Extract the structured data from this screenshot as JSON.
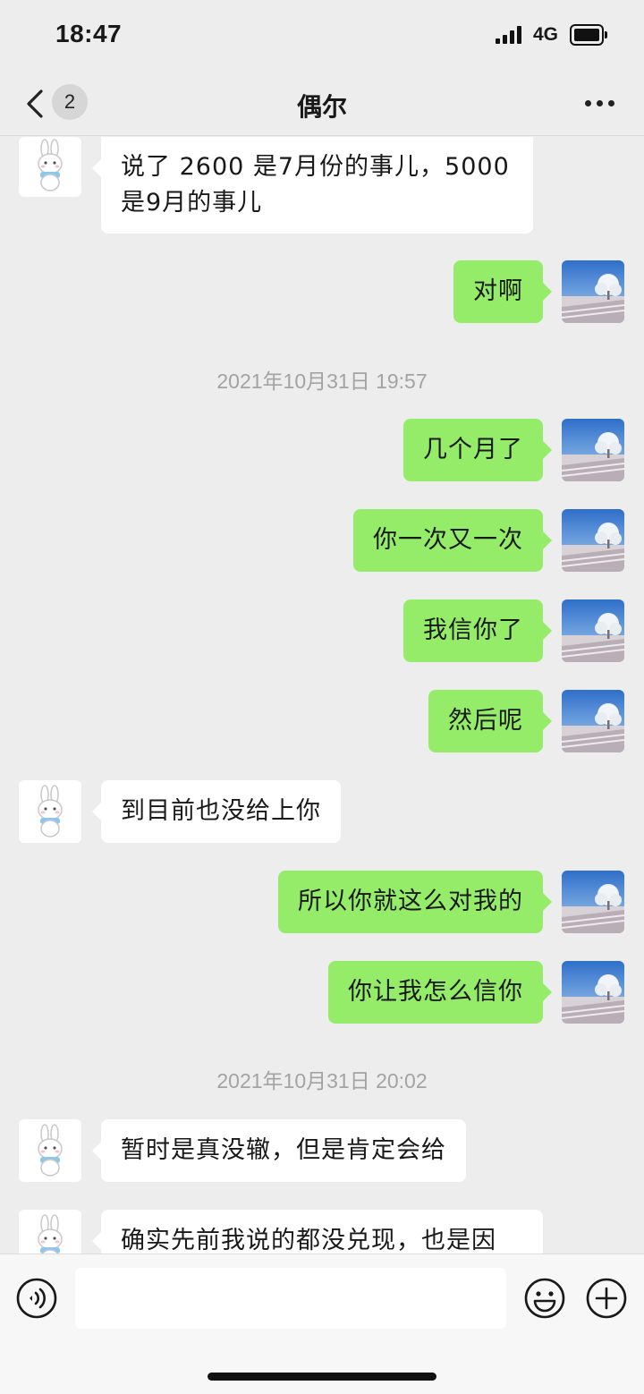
{
  "status_bar": {
    "time": "18:47",
    "network": "4G"
  },
  "nav": {
    "unread_count": "2",
    "title": "偶尔"
  },
  "messages": [
    {
      "side": "in",
      "text": "说了 2600 是7月份的事儿，5000 是9月的事儿"
    },
    {
      "side": "out",
      "text": "对啊"
    },
    {
      "timestamp": "2021年10月31日 19:57"
    },
    {
      "side": "out",
      "text": "几个月了"
    },
    {
      "side": "out",
      "text": "你一次又一次"
    },
    {
      "side": "out",
      "text": "我信你了"
    },
    {
      "side": "out",
      "text": "然后呢"
    },
    {
      "side": "in",
      "text": "到目前也没给上你"
    },
    {
      "side": "out",
      "text": "所以你就这么对我的"
    },
    {
      "side": "out",
      "text": "你让我怎么信你"
    },
    {
      "timestamp": "2021年10月31日 20:02"
    },
    {
      "side": "in",
      "text": "暂时是真没辙，但是肯定会给"
    },
    {
      "side": "in",
      "text": "确实先前我说的都没兑现，也是因"
    }
  ],
  "icons": {
    "back": "chevron-left-icon",
    "more": "ellipsis-icon",
    "voice": "voice-icon",
    "emoji": "smiley-icon",
    "plus": "plus-icon"
  },
  "colors": {
    "outgoing_bubble": "#95ec69",
    "incoming_bubble": "#ffffff",
    "background": "#ededed"
  }
}
